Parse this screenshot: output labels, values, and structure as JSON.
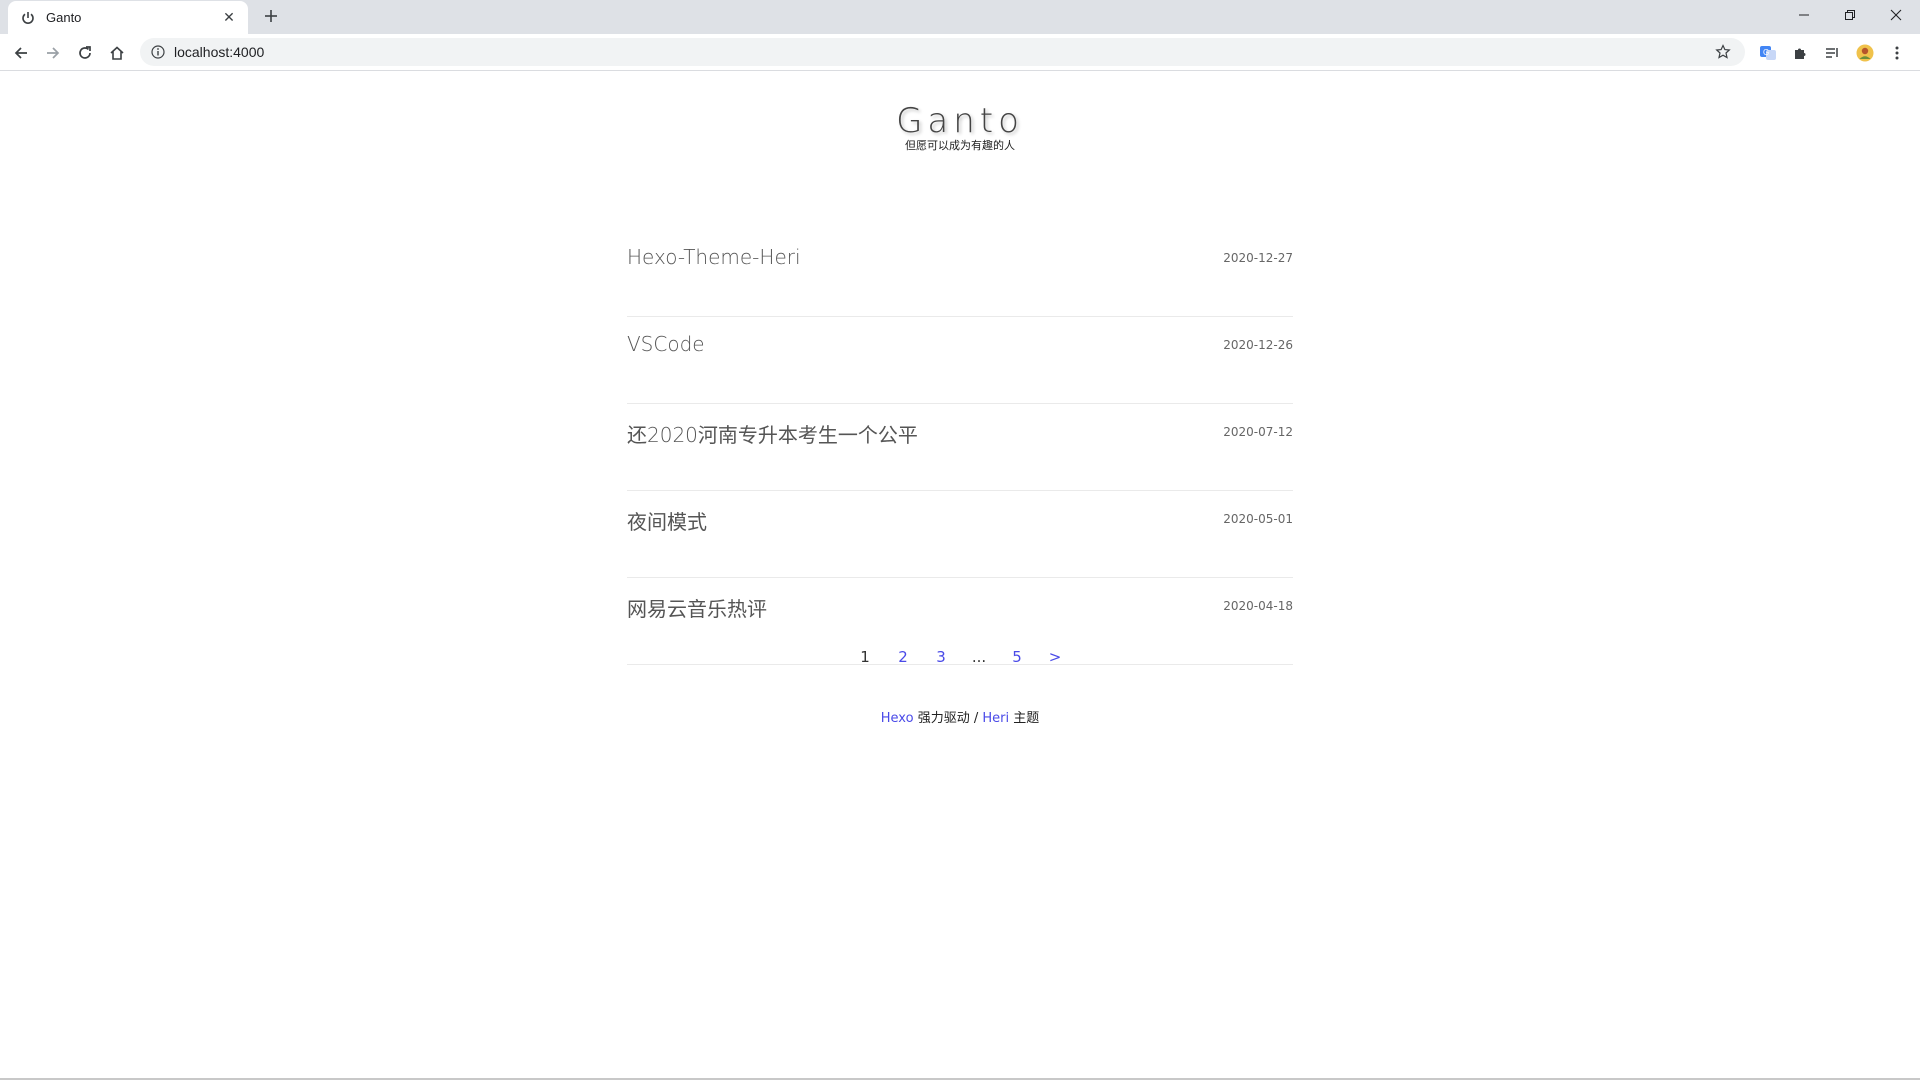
{
  "browser": {
    "tab_title": "Ganto",
    "url": "localhost:4000"
  },
  "site": {
    "title": "Ganto",
    "subtitle": "但愿可以成为有趣的人"
  },
  "posts": [
    {
      "title": "Hexo-Theme-Heri",
      "date": "2020-12-27"
    },
    {
      "title": "VSCode",
      "date": "2020-12-26"
    },
    {
      "title": "还2020河南专升本考生一个公平",
      "date": "2020-07-12"
    },
    {
      "title": "夜间模式",
      "date": "2020-05-01"
    },
    {
      "title": "网易云音乐热评",
      "date": "2020-04-18"
    }
  ],
  "pagination": {
    "current": "1",
    "page2": "2",
    "page3": "3",
    "ellipsis": "...",
    "last": "5",
    "next": ">"
  },
  "footer": {
    "hexo_link": "Hexo",
    "powered_text": " 强力驱动 / ",
    "heri_link": "Heri",
    "theme_text": " 主题"
  }
}
